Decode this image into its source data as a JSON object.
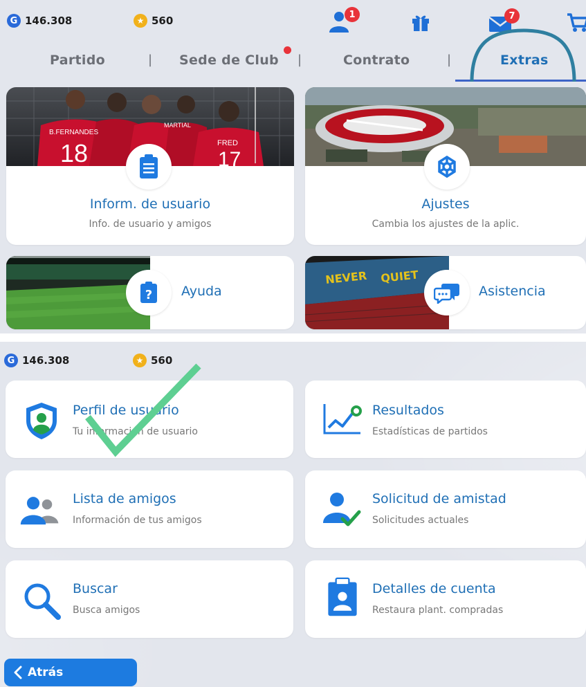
{
  "top_bar": {
    "gp": "146.308",
    "coins": "560",
    "friends_badge": "1",
    "mail_badge": "7"
  },
  "tabs": [
    {
      "label": "Partido"
    },
    {
      "label": "Sede de Club"
    },
    {
      "label": "Contrato"
    },
    {
      "label": "Extras"
    }
  ],
  "extras_cards": {
    "user_info": {
      "title": "Inform. de usuario",
      "subtitle": "Info. de usuario y amigos",
      "jersey_1": "B.FERNANDES",
      "jersey_num_1": "18",
      "jersey_2": "MARTIAL",
      "jersey_3": "FRED",
      "jersey_num_3": "17"
    },
    "settings": {
      "title": "Ajustes",
      "subtitle": "Cambia los ajustes de la aplic."
    },
    "help": {
      "title": "Ayuda"
    },
    "assistance": {
      "title": "Asistencia"
    }
  },
  "second_bar": {
    "gp": "146.308",
    "coins": "560"
  },
  "user_menu": [
    {
      "title": "Perfil de usuario",
      "subtitle": "Tu información de usuario",
      "icon": "shield-user-icon"
    },
    {
      "title": "Resultados",
      "subtitle": "Estadísticas de partidos",
      "icon": "chart-icon"
    },
    {
      "title": "Lista de amigos",
      "subtitle": "Información de tus amigos",
      "icon": "friends-icon"
    },
    {
      "title": "Solicitud de amistad",
      "subtitle": "Solicitudes actuales",
      "icon": "friend-request-icon"
    },
    {
      "title": "Buscar",
      "subtitle": "Busca amigos",
      "icon": "search-icon"
    },
    {
      "title": "Detalles de cuenta",
      "subtitle": "Restaura plant. compradas",
      "icon": "account-details-icon"
    }
  ],
  "back_button": {
    "label": "Atrás"
  },
  "colors": {
    "accent": "#1f6fb5",
    "button": "#1d7be0",
    "badge": "#e8333a",
    "check": "#5ecf92"
  }
}
